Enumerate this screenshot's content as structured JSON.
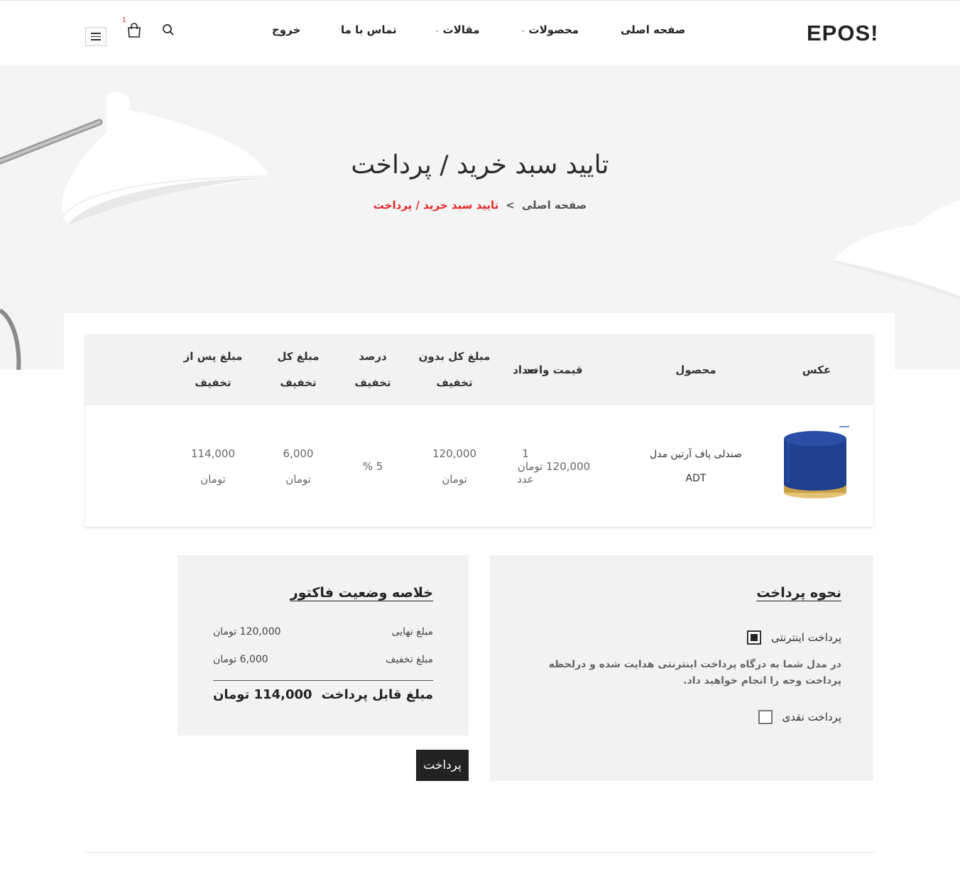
{
  "header": {
    "logo": "EPOS!",
    "nav": {
      "home": "صفحه اصلی",
      "products": "محصولات",
      "articles": "مقالات",
      "contact": "تماس با ما",
      "logout": "خروج"
    },
    "cart_count": "1",
    "icons": [
      "menu-icon",
      "cart-icon",
      "search-icon",
      "chevron-down-icon"
    ]
  },
  "hero": {
    "title": "تایید سبد خرید / پرداخت",
    "breadcrumb": {
      "home": "صفحه اصلی",
      "separator": ">",
      "current": "تایید سبد خرید / پرداخت"
    }
  },
  "cart_table": {
    "columns": {
      "image": "عکس",
      "product": "محصول",
      "unit_price": "قیمت واحد",
      "quantity": "تعداد",
      "total_no_discount_1": "مبلغ کل بدون",
      "total_no_discount_2": "تخفیف",
      "discount_percent_1": "درصد",
      "discount_percent_2": "تخفیف",
      "discount_total_1": "مبلغ کل",
      "discount_total_2": "تخفیف",
      "after_discount_1": "مبلغ پس از",
      "after_discount_2": "تخفیف"
    },
    "rows": [
      {
        "product_line1": "صندلی پاف آرتین مدل",
        "product_line2": "ADT",
        "unit_price": "120,000 تومان",
        "quantity": "1",
        "quantity_unit": "عدد",
        "total_no_discount": "120,000",
        "total_no_discount_unit": "تومان",
        "discount_percent": "5 %",
        "discount_total": "6,000",
        "discount_total_unit": "تومان",
        "after_discount": "114,000",
        "after_discount_unit": "تومان"
      }
    ]
  },
  "payment_method": {
    "title": "نحوه پرداخت",
    "online_label": "پرداخت اینترنتی",
    "online_checked": true,
    "online_desc": "در مدل شما به درگاه پرداخت اینترنتی هدایت شده و درلحظه پرداخت وجه را انجام خواهید داد.",
    "cash_label": "پرداخت نقدی",
    "cash_checked": false
  },
  "invoice_summary": {
    "title": "خلاصه وضعیت فاکتور",
    "final_label": "مبلغ نهایی",
    "final_value": "120,000 تومان",
    "discount_label": "مبلغ تخفیف",
    "discount_value": "6,000 تومان",
    "payable_label": "مبلغ قابل پرداخت",
    "payable_value": "114,000 تومان"
  },
  "pay_button_label": "پرداخت",
  "colors": {
    "accent": "#e32b2b",
    "panel": "#f2f2f2",
    "hero_bg": "#f4f4f4",
    "button": "#222222",
    "product": "#1f3f8f",
    "product_base": "#c9a04a"
  }
}
